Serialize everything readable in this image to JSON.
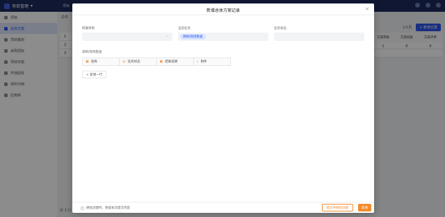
{
  "app": {
    "title": "项目管理",
    "top_link": "项目",
    "sidebar": [
      {
        "label": "项目"
      },
      {
        "label": "总体方案",
        "active": true
      },
      {
        "label": "项目策划"
      },
      {
        "label": "采购招标"
      },
      {
        "label": "项目实施"
      },
      {
        "label": "开通验收"
      },
      {
        "label": "资料归档"
      },
      {
        "label": "应用库"
      }
    ],
    "breadcrumb": "总体",
    "pager": "1/1页",
    "add_button": "+ 新增记录",
    "rows": [
      "1",
      "2",
      "3"
    ],
    "right_headers": [
      "方案审核",
      "方案批复",
      "方案评审"
    ],
    "right_values": [
      "1",
      "0",
      "0"
    ],
    "footer": "共 3 行"
  },
  "modal": {
    "title": "新增总体方案记录",
    "fields": {
      "project_label": "所属项目",
      "task_label": "当前任务",
      "task_value": "调研/现场勘查",
      "status_label": "任务状态"
    },
    "subtable": {
      "label": "调研/现场勘查",
      "columns": [
        "名称",
        "任务状态",
        "结果说明",
        "附件"
      ]
    },
    "add_row": "+ 新增一行",
    "keep_open": "继续创建时，保留本次提交内容",
    "submit_continue": "提交并继续创建",
    "submit": "新增"
  },
  "colors": {
    "accent": "#f28b2c",
    "primary": "#2f54eb",
    "nav": "#1d2b5c"
  }
}
